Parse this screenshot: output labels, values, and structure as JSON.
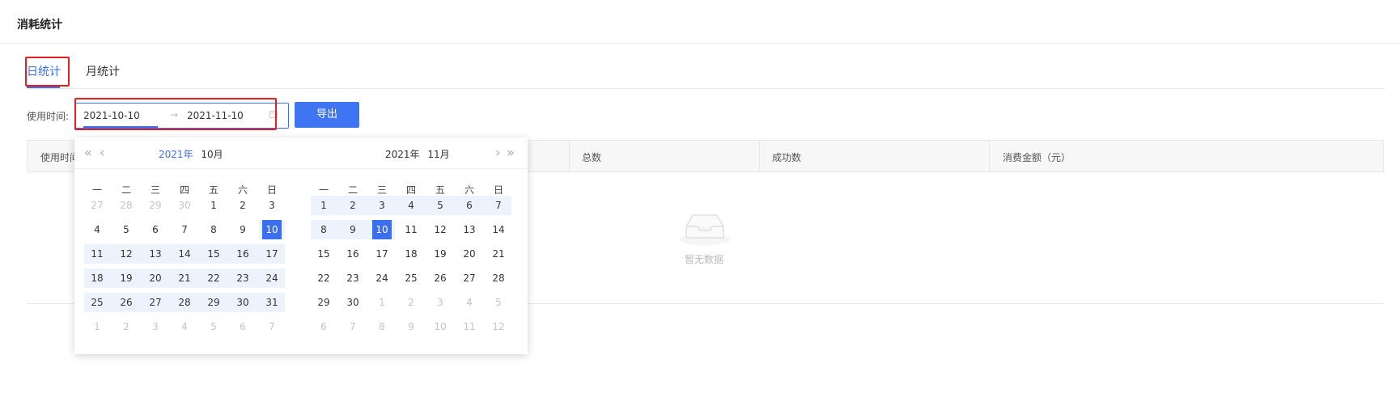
{
  "page": {
    "title": "消耗统计",
    "tabs": [
      {
        "label": "日统计",
        "active": true
      },
      {
        "label": "月统计",
        "active": false
      }
    ]
  },
  "filter": {
    "label": "使用时间:",
    "start_date": "2021-10-10",
    "separator": "→",
    "end_date": "2021-11-10",
    "export_label": "导出"
  },
  "table": {
    "columns": [
      "使用时间",
      "总数",
      "成功数",
      "消费金额（元）"
    ],
    "empty_text": "暂无数据"
  },
  "calendar": {
    "weekdays": [
      "一",
      "二",
      "三",
      "四",
      "五",
      "六",
      "日"
    ],
    "nav": {
      "prev_year": "«",
      "prev_month": "‹",
      "next_month": "›",
      "next_year": "»"
    },
    "left": {
      "year_label": "2021年",
      "month_label": "10月",
      "weeks": [
        [
          "27",
          "28",
          "29",
          "30",
          "1",
          "2",
          "3"
        ],
        [
          "4",
          "5",
          "6",
          "7",
          "8",
          "9",
          "10"
        ],
        [
          "11",
          "12",
          "13",
          "14",
          "15",
          "16",
          "17"
        ],
        [
          "18",
          "19",
          "20",
          "21",
          "22",
          "23",
          "24"
        ],
        [
          "25",
          "26",
          "27",
          "28",
          "29",
          "30",
          "31"
        ],
        [
          "1",
          "2",
          "3",
          "4",
          "5",
          "6",
          "7"
        ]
      ]
    },
    "right": {
      "year_label": "2021年",
      "month_label": "11月",
      "weeks": [
        [
          "1",
          "2",
          "3",
          "4",
          "5",
          "6",
          "7"
        ],
        [
          "8",
          "9",
          "10",
          "11",
          "12",
          "13",
          "14"
        ],
        [
          "15",
          "16",
          "17",
          "18",
          "19",
          "20",
          "21"
        ],
        [
          "22",
          "23",
          "24",
          "25",
          "26",
          "27",
          "28"
        ],
        [
          "29",
          "30",
          "1",
          "2",
          "3",
          "4",
          "5"
        ],
        [
          "6",
          "7",
          "8",
          "9",
          "10",
          "11",
          "12"
        ]
      ]
    }
  },
  "colors": {
    "accent": "#3c6ff0",
    "highlight_box": "#e81e1e",
    "range_band": "#edf3fc"
  }
}
